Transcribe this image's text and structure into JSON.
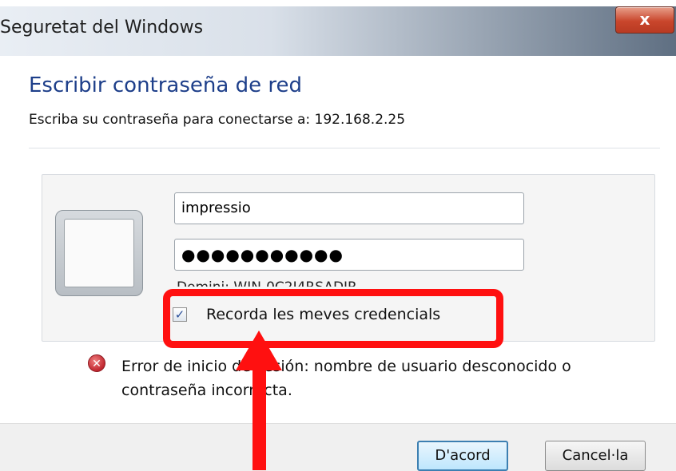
{
  "window": {
    "title": "Seguretat del Windows",
    "close_glyph": "x"
  },
  "header": {
    "heading": "Escribir contraseña de red",
    "subheading": "Escriba su contraseña para conectarse a: 192.168.2.25"
  },
  "credentials": {
    "username_value": "impressio",
    "password_value": "●●●●●●●●●●●",
    "domain_text": "Domini: WIN-0C2I4RSADIR",
    "remember_label": "Recorda les meves credencials",
    "remember_checked": true
  },
  "error": {
    "icon": "error-x-icon",
    "message": "Error de inicio de sesión: nombre de usuario desconocido o contraseña incorrecta."
  },
  "footer": {
    "ok_label": "D'acord",
    "cancel_label": "Cancel·la"
  },
  "annotation": {
    "color": "#ff1010"
  }
}
